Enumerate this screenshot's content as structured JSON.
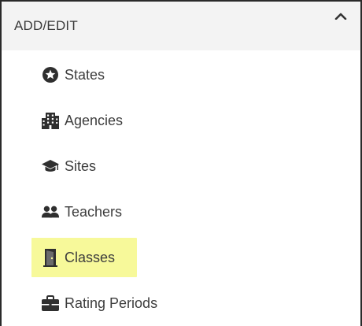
{
  "panel": {
    "title": "ADD/EDIT",
    "collapse_icon": "chevron-up-icon"
  },
  "menu": {
    "items": [
      {
        "label": "States",
        "icon": "star-circle-icon"
      },
      {
        "label": "Agencies",
        "icon": "building-icon"
      },
      {
        "label": "Sites",
        "icon": "graduation-cap-icon"
      },
      {
        "label": "Teachers",
        "icon": "people-icon"
      },
      {
        "label": "Classes",
        "icon": "door-icon",
        "highlighted": true
      },
      {
        "label": "Rating Periods",
        "icon": "briefcase-icon"
      }
    ]
  },
  "colors": {
    "highlight": "#f7f99a",
    "icon": "#2f2f2f",
    "text": "#3d3d3d",
    "header_bg": "#f3f3f3"
  }
}
